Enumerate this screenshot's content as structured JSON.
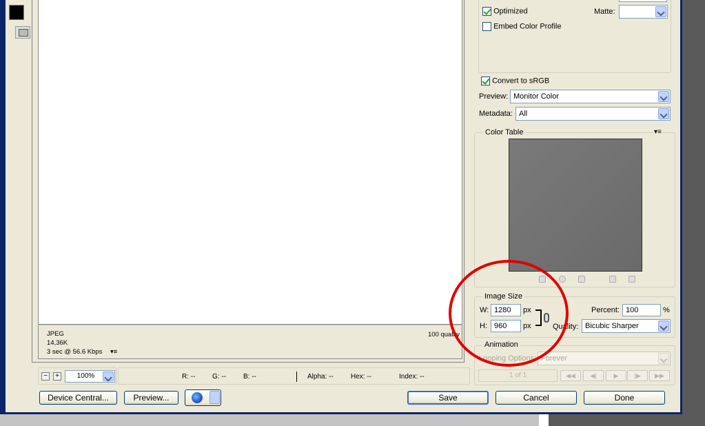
{
  "settings": {
    "optimized_label": "Optimized",
    "matte_label": "Matte:",
    "embed_color_profile_label": "Embed Color Profile",
    "convert_srgb_label": "Convert to sRGB",
    "preview_label": "Preview:",
    "preview_value": "Monitor Color",
    "metadata_label": "Metadata:",
    "metadata_value": "All"
  },
  "color_table": {
    "title": "Color Table"
  },
  "image_size": {
    "title": "Image Size",
    "w_label": "W:",
    "w_value": "1280",
    "h_label": "H:",
    "h_value": "960",
    "unit": "px",
    "percent_label": "Percent:",
    "percent_value": "100",
    "percent_unit": "%",
    "quality_label": "Quality:",
    "quality_value": "Bicubic Sharper"
  },
  "animation": {
    "title": "Animation",
    "looping_label": "Looping Options:",
    "looping_value": "Forever",
    "frame_counter": "1 of 1"
  },
  "info": {
    "format": "JPEG",
    "size": "14,36K",
    "download_time": "3 sec @ 56.6 Kbps",
    "quality": "100 quality"
  },
  "status": {
    "zoom": "100%",
    "r": "R: --",
    "g": "G: --",
    "b": "B: --",
    "alpha": "Alpha: --",
    "hex": "Hex: --",
    "index": "Index: --"
  },
  "buttons": {
    "device_central": "Device Central...",
    "preview": "Preview...",
    "save": "Save",
    "cancel": "Cancel",
    "done": "Done"
  }
}
